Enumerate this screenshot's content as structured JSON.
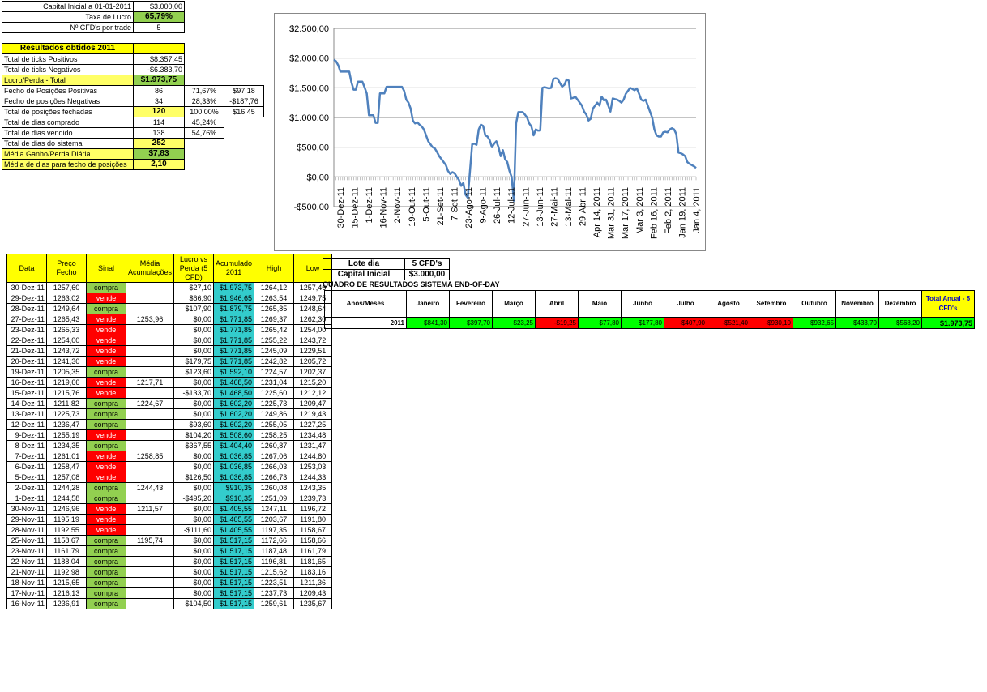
{
  "params": {
    "rows": [
      {
        "label": "Capital Inicial a 01-01-2011",
        "value": "$3.000,00"
      },
      {
        "label": "Taxa de Lucro",
        "value": "65,79%"
      },
      {
        "label": "Nº CFD's por trade",
        "value": "5"
      }
    ]
  },
  "results": {
    "title": "Resultados obtidos 2011",
    "rows": [
      {
        "label": "Total de ticks Positivos",
        "value": "$8.357,45",
        "pct": "",
        "extra": ""
      },
      {
        "label": "Total de ticks Negativos",
        "value": "-$6.383,70",
        "pct": "",
        "extra": ""
      },
      {
        "label": "Lucro/Perda - Total",
        "value": "$1.973,75",
        "pct": "",
        "extra": ""
      },
      {
        "label": "Fecho de Posições Positivas",
        "value": "86",
        "pct": "71,67%",
        "extra": "$97,18"
      },
      {
        "label": "Fecho de posições Negativas",
        "value": "34",
        "pct": "28,33%",
        "extra": "-$187,76"
      },
      {
        "label": "Total de posições fechadas",
        "value": "120",
        "pct": "100,00%",
        "extra": "$16,45"
      },
      {
        "label": "Total de dias comprado",
        "value": "114",
        "pct": "45,24%",
        "extra": ""
      },
      {
        "label": "Total de dias vendido",
        "value": "138",
        "pct": "54,76%",
        "extra": ""
      },
      {
        "label": "Total de dias do sistema",
        "value": "252",
        "pct": "",
        "extra": ""
      },
      {
        "label": "Média Ganho/Perda Diária",
        "value": "$7,83",
        "pct": "",
        "extra": ""
      },
      {
        "label": "Média de dias para fecho de posições",
        "value": "2,10",
        "pct": "",
        "extra": ""
      }
    ]
  },
  "chart_data": {
    "type": "line",
    "ylim": [
      -500,
      2500
    ],
    "yticks": [
      "$2.500,00",
      "$2.000,00",
      "$1.500,00",
      "$1.000,00",
      "$500,00",
      "$0,00",
      "-$500,00"
    ],
    "xlabels": [
      "30-Dez-11",
      "15-Dez-11",
      "1-Dez-11",
      "16-Nov-11",
      "2-Nov-11",
      "19-Out-11",
      "5-Out-11",
      "21-Set-11",
      "7-Set-11",
      "23-Ago-11",
      "9-Ago-11",
      "26-Jul-11",
      "12-Jul-11",
      "27-Jun-11",
      "13-Jun-11",
      "27-Mai-11",
      "13-Mai-11",
      "29-Abr-11",
      "Apr 14, 2011",
      "Mar 31, 2011",
      "Mar 17, 2011",
      "Mar 3, 2011",
      "Feb 16, 2011",
      "Feb 2, 2011",
      "Jan 19, 2011",
      "Jan 4, 2011"
    ],
    "values": [
      1973.75,
      1946.85,
      1879.75,
      1771.85,
      1771.85,
      1771.85,
      1771.85,
      1771.85,
      1592.1,
      1468.5,
      1468.5,
      1602.2,
      1602.2,
      1602.2,
      1508.6,
      1404.4,
      1036.85,
      1036.85,
      1036.85,
      910.35,
      910.35,
      1405.55,
      1405.55,
      1405.55,
      1517.15,
      1517.15,
      1517.15,
      1517.15,
      1517.15,
      1517.15,
      1517.15,
      1517.15,
      1450,
      1300,
      1250,
      1150,
      950,
      900,
      920,
      880,
      850,
      800,
      700,
      600,
      550,
      500,
      480,
      420,
      350,
      300,
      250,
      200,
      100,
      50,
      80,
      60,
      0,
      -50,
      -150,
      -100,
      -300,
      -350,
      100,
      550,
      560,
      540,
      800,
      880,
      860,
      700,
      680,
      620,
      500,
      560,
      600,
      500,
      350,
      450,
      300,
      250,
      100,
      0,
      -400,
      900,
      1090,
      1090,
      1090,
      1050,
      1000,
      900,
      850,
      700,
      800,
      780,
      780,
      1500,
      1510,
      1500,
      1490,
      1500,
      1650,
      1660,
      1650,
      1580,
      1520,
      1550,
      1640,
      1620,
      1320,
      1330,
      1350,
      1300,
      1250,
      1200,
      1100,
      1050,
      950,
      980,
      1150,
      1200,
      1250,
      1200,
      1350,
      1290,
      1300,
      1200,
      1100,
      1320,
      1310,
      1300,
      1280,
      1250,
      1300,
      1400,
      1450,
      1500,
      1480,
      1460,
      1490,
      1400,
      1300,
      1280,
      1300,
      1200,
      1100,
      1000,
      800,
      700,
      680,
      680,
      750,
      760,
      750,
      800,
      820,
      800,
      720,
      410,
      400,
      380,
      350,
      250,
      220,
      200,
      180,
      150
    ]
  },
  "trades": {
    "headers": [
      "Data",
      "Preço Fecho",
      "Sinal",
      "Média Acumulações",
      "Lucro vs Perda (5 CFD)",
      "Acumulado 2011",
      "High",
      "Low"
    ],
    "rows": [
      {
        "date": "30-Dez-11",
        "price": "1257,60",
        "signal": "compra",
        "avg": "",
        "pl": "$27,10",
        "acc": "$1.973,75",
        "high": "1264,12",
        "low": "1257,46"
      },
      {
        "date": "29-Dez-11",
        "price": "1263,02",
        "signal": "vende",
        "avg": "",
        "pl": "$66,90",
        "acc": "$1.946,65",
        "high": "1263,54",
        "low": "1249,75"
      },
      {
        "date": "28-Dez-11",
        "price": "1249,64",
        "signal": "compra",
        "avg": "",
        "pl": "$107,90",
        "acc": "$1.879,75",
        "high": "1265,85",
        "low": "1248,64"
      },
      {
        "date": "27-Dez-11",
        "price": "1265,43",
        "signal": "vende",
        "avg": "1253,96",
        "pl": "$0,00",
        "acc": "$1.771,85",
        "high": "1269,37",
        "low": "1262,30"
      },
      {
        "date": "23-Dez-11",
        "price": "1265,33",
        "signal": "vende",
        "avg": "",
        "pl": "$0,00",
        "acc": "$1.771,85",
        "high": "1265,42",
        "low": "1254,00"
      },
      {
        "date": "22-Dez-11",
        "price": "1254,00",
        "signal": "vende",
        "avg": "",
        "pl": "$0,00",
        "acc": "$1.771,85",
        "high": "1255,22",
        "low": "1243,72"
      },
      {
        "date": "21-Dez-11",
        "price": "1243,72",
        "signal": "vende",
        "avg": "",
        "pl": "$0,00",
        "acc": "$1.771,85",
        "high": "1245,09",
        "low": "1229,51"
      },
      {
        "date": "20-Dez-11",
        "price": "1241,30",
        "signal": "vende",
        "avg": "",
        "pl": "$179,75",
        "acc": "$1.771,85",
        "high": "1242,82",
        "low": "1205,72"
      },
      {
        "date": "19-Dez-11",
        "price": "1205,35",
        "signal": "compra",
        "avg": "",
        "pl": "$123,60",
        "acc": "$1.592,10",
        "high": "1224,57",
        "low": "1202,37"
      },
      {
        "date": "16-Dez-11",
        "price": "1219,66",
        "signal": "vende",
        "avg": "1217,71",
        "pl": "$0,00",
        "acc": "$1.468,50",
        "high": "1231,04",
        "low": "1215,20"
      },
      {
        "date": "15-Dez-11",
        "price": "1215,76",
        "signal": "vende",
        "avg": "",
        "pl": "-$133,70",
        "acc": "$1.468,50",
        "high": "1225,60",
        "low": "1212,12"
      },
      {
        "date": "14-Dez-11",
        "price": "1211,82",
        "signal": "compra",
        "avg": "1224,67",
        "pl": "$0,00",
        "acc": "$1.602,20",
        "high": "1225,73",
        "low": "1209,47"
      },
      {
        "date": "13-Dez-11",
        "price": "1225,73",
        "signal": "compra",
        "avg": "",
        "pl": "$0,00",
        "acc": "$1.602,20",
        "high": "1249,86",
        "low": "1219,43"
      },
      {
        "date": "12-Dez-11",
        "price": "1236,47",
        "signal": "compra",
        "avg": "",
        "pl": "$93,60",
        "acc": "$1.602,20",
        "high": "1255,05",
        "low": "1227,25"
      },
      {
        "date": "9-Dez-11",
        "price": "1255,19",
        "signal": "vende",
        "avg": "",
        "pl": "$104,20",
        "acc": "$1.508,60",
        "high": "1258,25",
        "low": "1234,48"
      },
      {
        "date": "8-Dez-11",
        "price": "1234,35",
        "signal": "compra",
        "avg": "",
        "pl": "$367,55",
        "acc": "$1.404,40",
        "high": "1260,87",
        "low": "1231,47"
      },
      {
        "date": "7-Dez-11",
        "price": "1261,01",
        "signal": "vende",
        "avg": "1258,85",
        "pl": "$0,00",
        "acc": "$1.036,85",
        "high": "1267,06",
        "low": "1244,80"
      },
      {
        "date": "6-Dez-11",
        "price": "1258,47",
        "signal": "vende",
        "avg": "",
        "pl": "$0,00",
        "acc": "$1.036,85",
        "high": "1266,03",
        "low": "1253,03"
      },
      {
        "date": "5-Dez-11",
        "price": "1257,08",
        "signal": "vende",
        "avg": "",
        "pl": "$126,50",
        "acc": "$1.036,85",
        "high": "1266,73",
        "low": "1244,33"
      },
      {
        "date": "2-Dez-11",
        "price": "1244,28",
        "signal": "compra",
        "avg": "1244,43",
        "pl": "$0,00",
        "acc": "$910,35",
        "high": "1260,08",
        "low": "1243,35"
      },
      {
        "date": "1-Dez-11",
        "price": "1244,58",
        "signal": "compra",
        "avg": "",
        "pl": "-$495,20",
        "acc": "$910,35",
        "high": "1251,09",
        "low": "1239,73"
      },
      {
        "date": "30-Nov-11",
        "price": "1246,96",
        "signal": "vende",
        "avg": "1211,57",
        "pl": "$0,00",
        "acc": "$1.405,55",
        "high": "1247,11",
        "low": "1196,72"
      },
      {
        "date": "29-Nov-11",
        "price": "1195,19",
        "signal": "vende",
        "avg": "",
        "pl": "$0,00",
        "acc": "$1.405,55",
        "high": "1203,67",
        "low": "1191,80"
      },
      {
        "date": "28-Nov-11",
        "price": "1192,55",
        "signal": "vende",
        "avg": "",
        "pl": "-$111,60",
        "acc": "$1.405,55",
        "high": "1197,35",
        "low": "1158,67"
      },
      {
        "date": "25-Nov-11",
        "price": "1158,67",
        "signal": "compra",
        "avg": "1195,74",
        "pl": "$0,00",
        "acc": "$1.517,15",
        "high": "1172,66",
        "low": "1158,66"
      },
      {
        "date": "23-Nov-11",
        "price": "1161,79",
        "signal": "compra",
        "avg": "",
        "pl": "$0,00",
        "acc": "$1.517,15",
        "high": "1187,48",
        "low": "1161,79"
      },
      {
        "date": "22-Nov-11",
        "price": "1188,04",
        "signal": "compra",
        "avg": "",
        "pl": "$0,00",
        "acc": "$1.517,15",
        "high": "1196,81",
        "low": "1181,65"
      },
      {
        "date": "21-Nov-11",
        "price": "1192,98",
        "signal": "compra",
        "avg": "",
        "pl": "$0,00",
        "acc": "$1.517,15",
        "high": "1215,62",
        "low": "1183,16"
      },
      {
        "date": "18-Nov-11",
        "price": "1215,65",
        "signal": "compra",
        "avg": "",
        "pl": "$0,00",
        "acc": "$1.517,15",
        "high": "1223,51",
        "low": "1211,36"
      },
      {
        "date": "17-Nov-11",
        "price": "1216,13",
        "signal": "compra",
        "avg": "",
        "pl": "$0,00",
        "acc": "$1.517,15",
        "high": "1237,73",
        "low": "1209,43"
      },
      {
        "date": "16-Nov-11",
        "price": "1236,91",
        "signal": "compra",
        "avg": "",
        "pl": "$104,50",
        "acc": "$1.517,15",
        "high": "1259,61",
        "low": "1235,67"
      }
    ]
  },
  "lote": {
    "rows": [
      {
        "label": "Lote dia",
        "value": "5 CFD's"
      },
      {
        "label": "Capital Inicial",
        "value": "$3.000,00"
      }
    ]
  },
  "yearly": {
    "title": "QUADRO DE RESULTADOS SISTEMA END-OF-DAY",
    "headers": [
      "Anos/Meses",
      "Janeiro",
      "Fevereiro",
      "Março",
      "Abril",
      "Maio",
      "Junho",
      "Julho",
      "Agosto",
      "Setembro",
      "Outubro",
      "Novembro",
      "Dezembro",
      "Total Anual - 5 CFD's"
    ],
    "row": {
      "year": "2011",
      "months": [
        "$841,30",
        "$397,70",
        "$23,25",
        "-$19,25",
        "$77,80",
        "$177,80",
        "-$407,90",
        "-$521,40",
        "-$930,10",
        "$932,65",
        "$433,70",
        "$568,20"
      ],
      "negative": [
        false,
        false,
        false,
        true,
        false,
        false,
        true,
        true,
        true,
        false,
        false,
        false
      ],
      "total": "$1.973,75"
    }
  },
  "colors": {
    "line": "#4f81bd",
    "header_yellow": "#ffff00",
    "light_yellow": "#ffff66",
    "buy_green": "#92d050",
    "sell_red": "#ff0000",
    "acc_cyan": "#33cccc",
    "total_green": "#00ff00"
  }
}
